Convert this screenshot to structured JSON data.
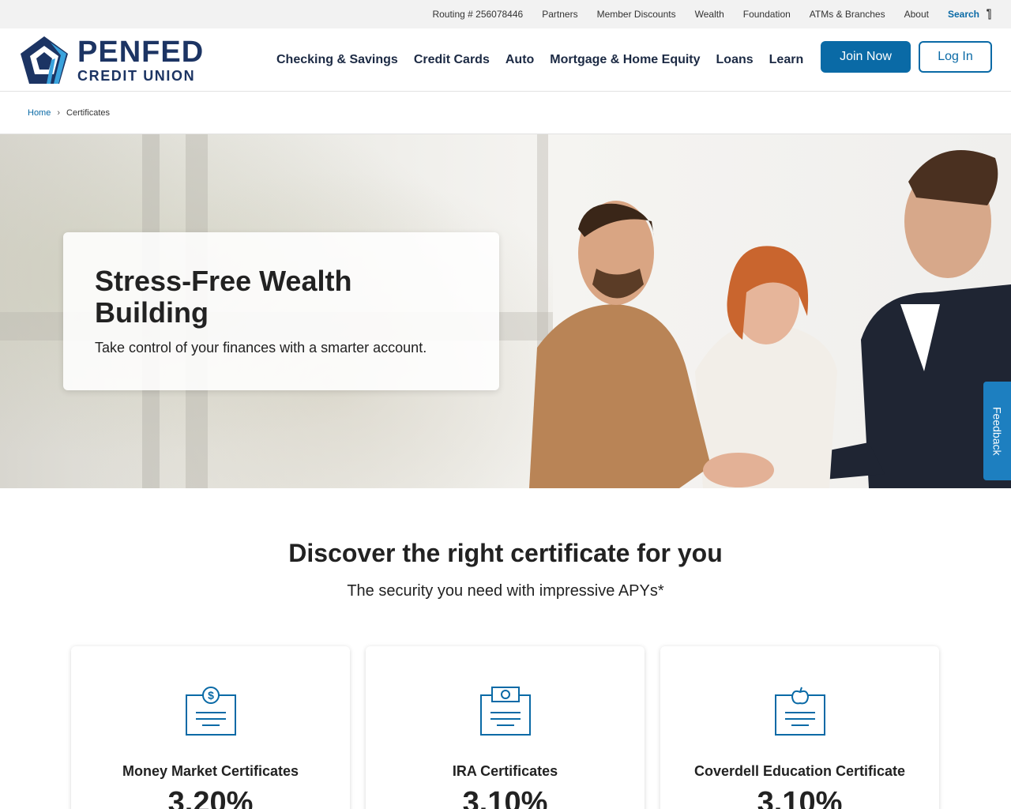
{
  "utility": {
    "routing": "Routing # 256078446",
    "links": [
      "Partners",
      "Member Discounts",
      "Wealth",
      "Foundation",
      "ATMs & Branches",
      "About"
    ],
    "search_label": "Search"
  },
  "logo": {
    "brand": "PENFED",
    "sub": "CREDIT UNION"
  },
  "nav": [
    "Checking & Savings",
    "Credit Cards",
    "Auto",
    "Mortgage & Home Equity",
    "Loans",
    "Learn"
  ],
  "buttons": {
    "join": "Join Now",
    "login": "Log In"
  },
  "breadcrumb": {
    "home": "Home",
    "separator": "›",
    "current": "Certificates"
  },
  "hero": {
    "title": "Stress-Free Wealth Building",
    "subtitle": "Take control of your finances with a smarter account."
  },
  "feedback": "Feedback",
  "discover": {
    "title": "Discover the right certificate for you",
    "subtitle": "The security you need with impressive APYs*"
  },
  "cards": [
    {
      "title": "Money Market Certificates",
      "rate": "3.20%",
      "icon": "dollar-certificate-icon"
    },
    {
      "title": "IRA Certificates",
      "rate": "3.10%",
      "icon": "cash-certificate-icon"
    },
    {
      "title": "Coverdell Education Certificate",
      "rate": "3.10%",
      "icon": "apple-certificate-icon"
    }
  ],
  "colors": {
    "brand_blue": "#0a6aa6",
    "navy": "#1c3463",
    "feedback_blue": "#1d7fc0"
  }
}
